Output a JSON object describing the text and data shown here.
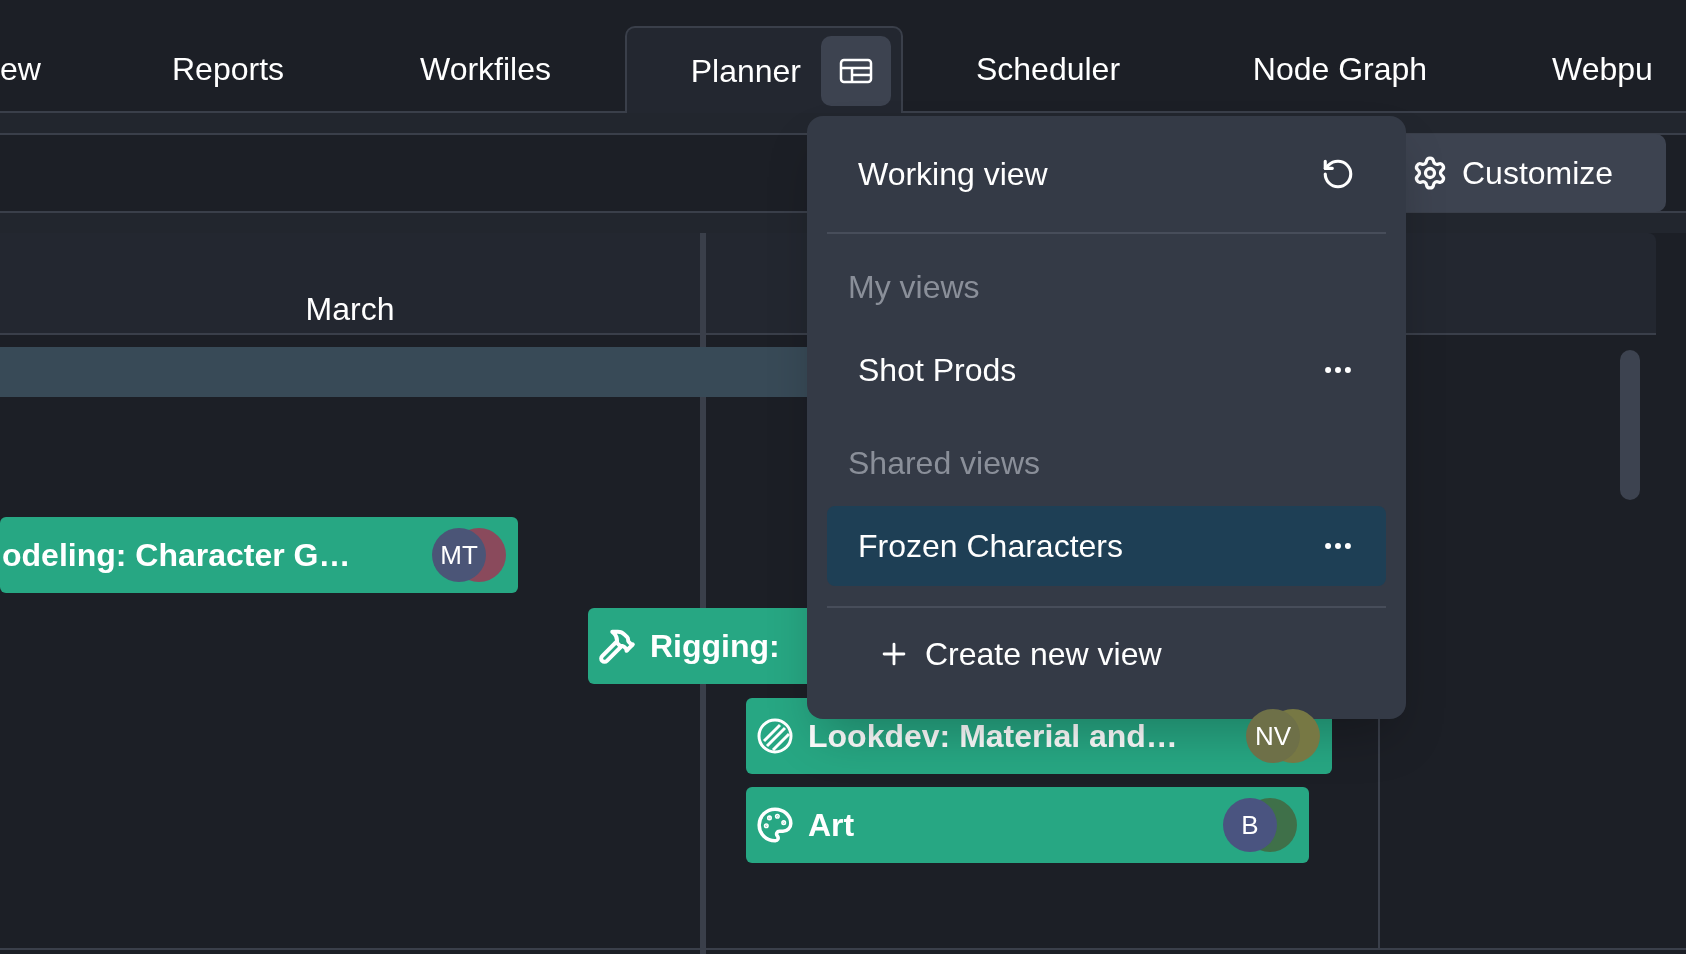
{
  "tabs": [
    {
      "label": "ew",
      "selected": false
    },
    {
      "label": "Reports",
      "selected": false
    },
    {
      "label": "Workfiles",
      "selected": false
    },
    {
      "label": "Planner",
      "selected": true
    },
    {
      "label": "Scheduler",
      "selected": false
    },
    {
      "label": "Node Graph",
      "selected": false
    },
    {
      "label": "Webpu",
      "selected": false
    }
  ],
  "customize_button": {
    "label": "Customize"
  },
  "timeline": {
    "month": "March"
  },
  "bars": [
    {
      "title": "odeling: Character G…",
      "avatars": [
        {
          "initials": "MT",
          "color": "#4b5577"
        },
        {
          "color": "#8a4a5c"
        }
      ]
    },
    {
      "title": "Rigging:"
    },
    {
      "title": "Lookdev: Material and…",
      "avatars": [
        {
          "initials": "NV",
          "color": "#6e7048"
        },
        {
          "color": "#777844"
        }
      ]
    },
    {
      "title": "Art",
      "avatars": [
        {
          "initials": "B",
          "color": "#4a5480"
        },
        {
          "color": "#3f7049"
        }
      ]
    }
  ],
  "view_menu": {
    "working_view": "Working view",
    "sections": [
      {
        "heading": "My views",
        "items": [
          {
            "label": "Shot Prods",
            "selected": false
          }
        ]
      },
      {
        "heading": "Shared views",
        "items": [
          {
            "label": "Frozen Characters",
            "selected": true
          }
        ]
      }
    ],
    "create_label": "Create new view"
  }
}
